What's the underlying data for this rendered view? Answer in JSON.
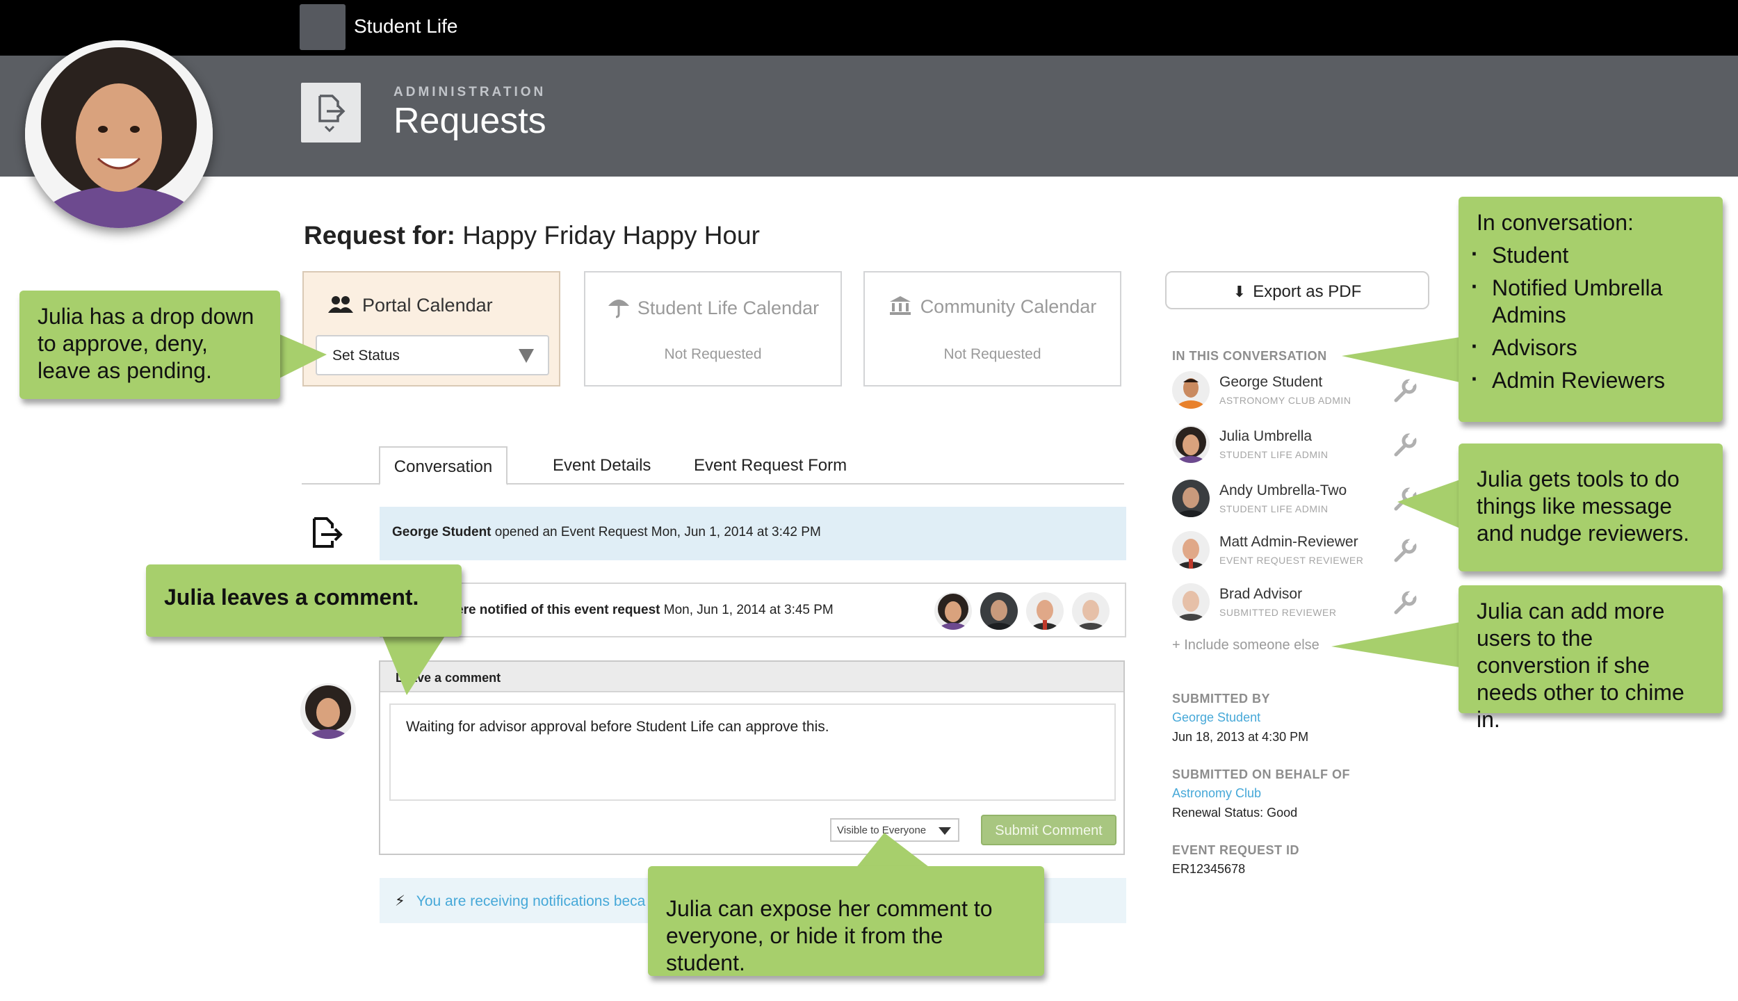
{
  "topbar": {
    "app_title": "Student Life"
  },
  "header": {
    "kicker": "ADMINISTRATION",
    "title": "Requests"
  },
  "request": {
    "label": "Request for:",
    "name": "Happy Friday Happy Hour"
  },
  "calendars": [
    {
      "name": "Portal Calendar",
      "select_value": "Set Status",
      "icon": "users-icon"
    },
    {
      "name": "Student Life Calendar",
      "status": "Not Requested",
      "icon": "umbrella-icon"
    },
    {
      "name": "Community Calendar",
      "status": "Not Requested",
      "icon": "building-icon"
    }
  ],
  "tabs": [
    "Conversation",
    "Event Details",
    "Event Request Form"
  ],
  "activity": {
    "opened_user": "George Student",
    "opened_text": " opened an Event Request Mon, Jun 1, 2014 at 3:42 PM",
    "notified_bold": "ere notified of this event request",
    "notified_date": " Mon, Jun 1, 2014 at 3:45 PM"
  },
  "comment": {
    "heading": "Leave a comment",
    "text": "Waiting for advisor approval before Student Life can approve this.",
    "visibility": "Visible to Everyone",
    "submit": "Submit Comment"
  },
  "notification_text": "You are receiving notifications beca",
  "sidebar": {
    "export": "Export as PDF",
    "conversation_label": "IN THIS CONVERSATION",
    "people": [
      {
        "name": "George Student",
        "role": "ASTRONOMY CLUB ADMIN"
      },
      {
        "name": "Julia Umbrella",
        "role": "STUDENT LIFE ADMIN"
      },
      {
        "name": "Andy Umbrella-Two",
        "role": "STUDENT LIFE ADMIN"
      },
      {
        "name": "Matt Admin-Reviewer",
        "role": "EVENT REQUEST REVIEWER"
      },
      {
        "name": "Brad Advisor",
        "role": "SUBMITTED REVIEWER"
      }
    ],
    "include": "+ Include someone else",
    "submitted_by_label": "SUBMITTED BY",
    "submitted_by": "George Student",
    "submitted_date": "Jun 18, 2013 at 4:30 PM",
    "behalf_label": "SUBMITTED ON BEHALF OF",
    "behalf": "Astronomy Club",
    "renewal": "Renewal Status: Good",
    "request_id_label": "EVENT REQUEST ID",
    "request_id": "ER12345678"
  },
  "callouts": {
    "dropdown": "Julia has a drop down to approve, deny, leave as pending.",
    "comment": "Julia leaves a comment.",
    "visibility": "Julia can expose her comment to everyone, or hide it from the student.",
    "conversation_title": "In conversation:",
    "conversation_items": [
      "Student",
      "Notified Umbrella Admins",
      "Advisors",
      "Admin Reviewers"
    ],
    "tools": "Julia gets tools to do things like message and nudge reviewers.",
    "add_users": "Julia can add more users to the converstion if she needs other to chime in."
  },
  "colors": {
    "callout_green": "#a7cf6c",
    "link_blue": "#46a8d8",
    "header_gray": "#5b5e63"
  }
}
